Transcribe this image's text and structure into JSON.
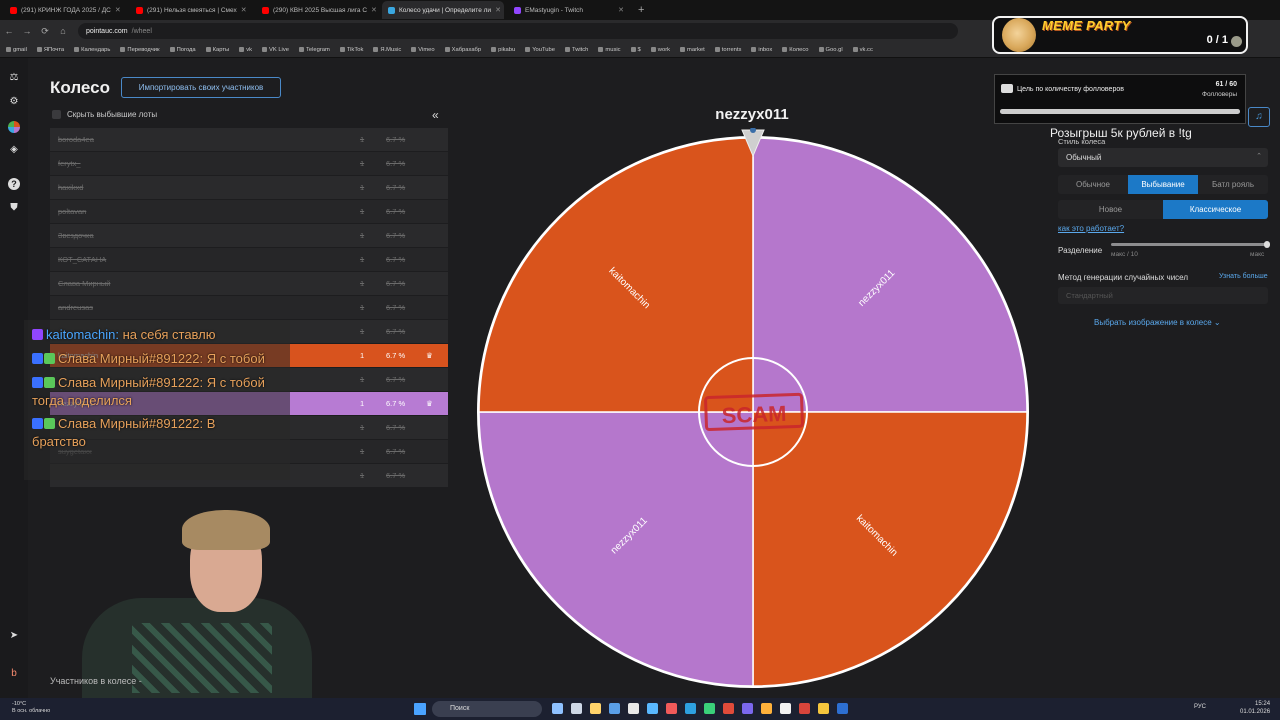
{
  "browser": {
    "tabs": [
      {
        "label": "(291) КРИНЖ ГОДА 2025 / ДС",
        "color": "#ff0000",
        "active": false
      },
      {
        "label": "(291) Нельзя смеяться | Смех",
        "color": "#ff0000",
        "active": false
      },
      {
        "label": "(290) КВН 2025 Высшая лига С",
        "color": "#ff0000",
        "active": false
      },
      {
        "label": "Колесо удачи | Определите ли",
        "color": "#3aa7e0",
        "active": true
      },
      {
        "label": "EMastyugin - Twitch",
        "color": "#9146ff",
        "active": false
      }
    ],
    "url_host": "pointauc.com",
    "url_path": "/wheel",
    "bookmarks": [
      "gmail",
      "ЯПочта",
      "Календарь",
      "Переводчик",
      "Погода",
      "Карты",
      "vk",
      "VK Live",
      "Telegram",
      "TikTok",
      "Я.Music",
      "Vimeo",
      "Хабрахабр",
      "pikabu",
      "YouTube",
      "Twitch",
      "music",
      "$",
      "work",
      "market",
      "torrents",
      "inbox",
      "Колесо",
      "Goo.gl",
      "vk.cc"
    ]
  },
  "overlay": {
    "title": "MEME PARTY",
    "score": "0 / 1"
  },
  "page": {
    "title": "Колесо",
    "import_button": "Импортировать своих участников",
    "hide_label": "Скрыть выбывшие лоты",
    "collapse_icon": "«",
    "footer_label": "Участников в колесе -"
  },
  "lots": [
    {
      "name": "boroda4ea",
      "amount": "1",
      "percent": "6.7 %",
      "state": "out"
    },
    {
      "name": "ferytx_",
      "amount": "1",
      "percent": "6.7 %",
      "state": "out"
    },
    {
      "name": "haxikxd",
      "amount": "1",
      "percent": "6.7 %",
      "state": "out"
    },
    {
      "name": "poltavan",
      "amount": "1",
      "percent": "6.7 %",
      "state": "out"
    },
    {
      "name": "Звездочка",
      "amount": "1",
      "percent": "6.7 %",
      "state": "out"
    },
    {
      "name": "КОТ_САТАНА",
      "amount": "1",
      "percent": "6.7 %",
      "state": "out"
    },
    {
      "name": "Слава Мирный",
      "amount": "1",
      "percent": "6.7 %",
      "state": "out"
    },
    {
      "name": "andreusas",
      "amount": "1",
      "percent": "6.7 %",
      "state": "out"
    },
    {
      "name": "",
      "amount": "1",
      "percent": "6.7 %",
      "state": "out"
    },
    {
      "name": "kaitomachin",
      "amount": "1",
      "percent": "6.7 %",
      "state": "orange"
    },
    {
      "name": "",
      "amount": "1",
      "percent": "6.7 %",
      "state": "out"
    },
    {
      "name": "nezzyx011",
      "amount": "1",
      "percent": "6.7 %",
      "state": "purple"
    },
    {
      "name": "",
      "amount": "1",
      "percent": "6.7 %",
      "state": "out"
    },
    {
      "name": "suygetaxx",
      "amount": "1",
      "percent": "6.7 %",
      "state": "out"
    },
    {
      "name": "",
      "amount": "1",
      "percent": "6.7 %",
      "state": "out"
    }
  ],
  "chat": [
    {
      "user": "kaitomachin:",
      "text": " на себя ставлю"
    },
    {
      "user": "",
      "text": "Слава Мирный#891222: Я с тобой"
    },
    {
      "user": "",
      "text": "Слава Мирный#891222: Я с тобой тогда поделился"
    },
    {
      "user": "",
      "text": "Слава Мирный#891222: В братство"
    }
  ],
  "wheel": {
    "winner": "nezzyx011",
    "center_stamp": "SCAM",
    "segments": [
      {
        "label": "nezzyx011",
        "color": "#b577cc"
      },
      {
        "label": "kaitomachin",
        "color": "#d9541c"
      },
      {
        "label": "nezzyx011",
        "color": "#b577cc"
      },
      {
        "label": "kaitomachin",
        "color": "#d9541c"
      }
    ]
  },
  "right_panel": {
    "goal_title": "Цель по количеству фолловеров",
    "goal_count": "61 / 60",
    "goal_type": "Фолловеры",
    "goal_progress": 1.0,
    "giveaway": "Розыгрыш 5к рублей в !tg",
    "wheel_style_label": "Стиль колеса",
    "wheel_style_value": "Обычный",
    "mode_options": [
      "Обычное",
      "Выбывание",
      "Батл рояль"
    ],
    "mode_selected": 1,
    "variant_options": [
      "Новое",
      "Классическое"
    ],
    "variant_selected": 1,
    "how_link": "как это работает?",
    "split_label": "Разделение",
    "split_min": "макс / 10",
    "split_max": "макс",
    "rng_label": "Метод генерации случайных чисел",
    "rng_link": "Узнать больше",
    "rng_value": "Стандартный",
    "image_link": "Выбрать изображение в колесе"
  },
  "taskbar": {
    "weather_temp": "-10°C",
    "weather_text": "В осн. облачно",
    "search": "Поиск",
    "lang": "РУС",
    "time": "15:24",
    "date": "01.01.2026"
  }
}
